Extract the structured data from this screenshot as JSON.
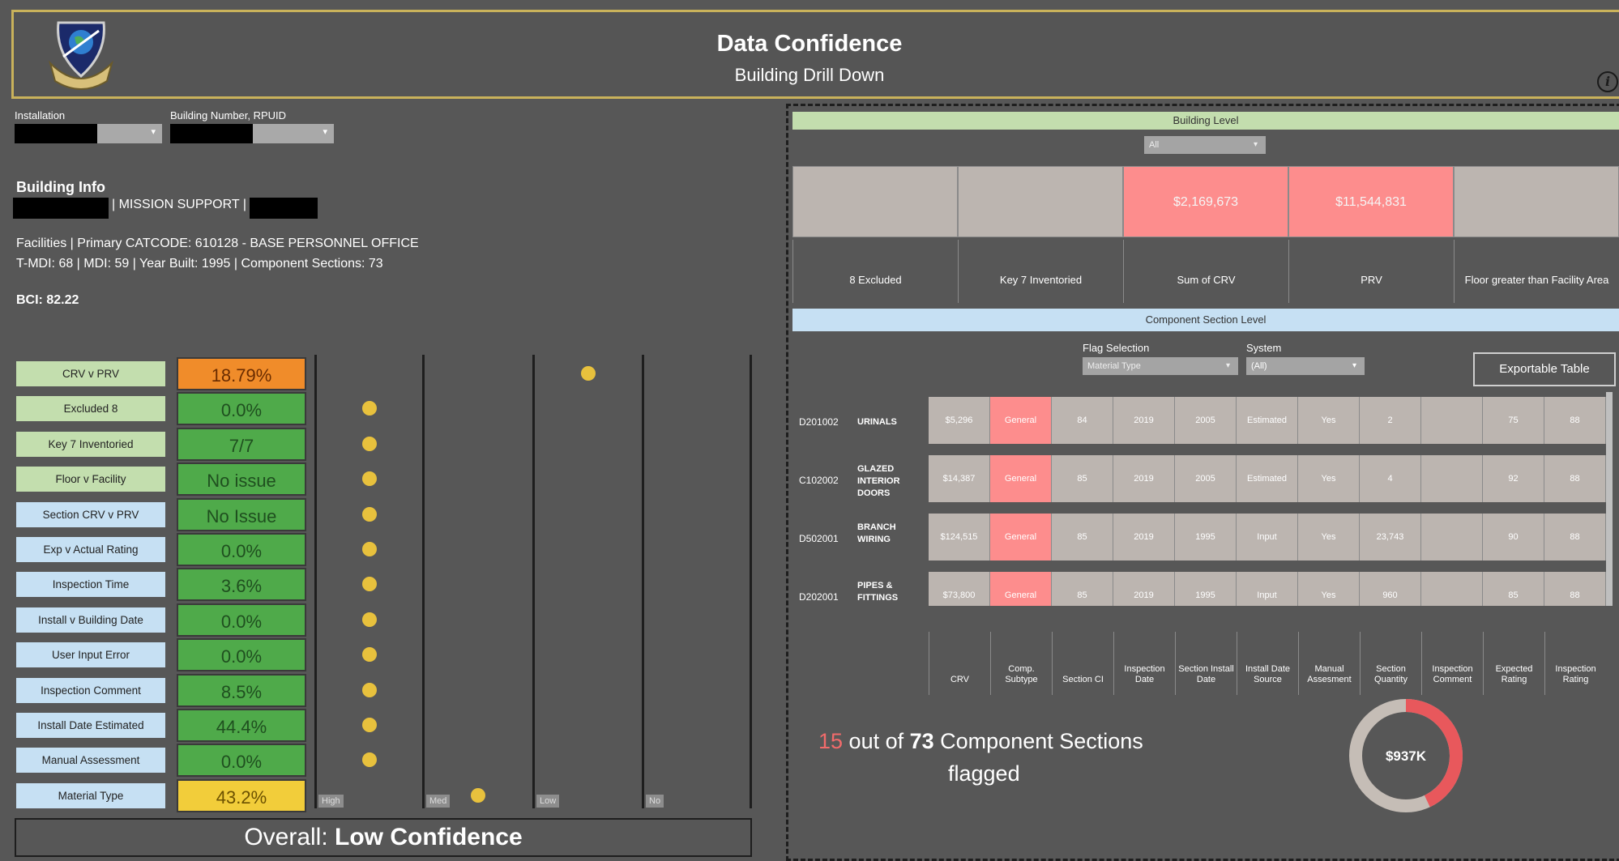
{
  "header": {
    "title": "Data Confidence",
    "subtitle": "Building Drill Down",
    "info_icon": "info-icon",
    "border_color": "#c9b25b"
  },
  "filters": {
    "installation_label": "Installation",
    "building_label": "Building Number, RPUID"
  },
  "building_info": {
    "title": "Building Info",
    "mission_text": "| MISSION SUPPORT |",
    "facilities_line": "Facilities | Primary CATCODE: 610128 - BASE PERSONNEL OFFICE",
    "mdi_line": "T-MDI:  68 | MDI: 59  | Year Built: 1995 | Component Sections: 73",
    "bci": "BCI: 82.22"
  },
  "metrics": [
    {
      "label": "CRV v PRV",
      "value": "18.79%",
      "status": "orange",
      "level": "Low"
    },
    {
      "label": "Excluded 8",
      "value": "0.0%",
      "status": "green",
      "level": "High"
    },
    {
      "label": "Key 7 Inventoried",
      "value": "7/7",
      "status": "green",
      "level": "High"
    },
    {
      "label": "Floor v Facility",
      "value": "No issue",
      "status": "green",
      "level": "High"
    },
    {
      "label": "Section CRV v PRV",
      "value": "No Issue",
      "status": "green",
      "level": "High"
    },
    {
      "label": "Exp v Actual Rating",
      "value": "0.0%",
      "status": "green",
      "level": "High"
    },
    {
      "label": "Inspection Time",
      "value": "3.6%",
      "status": "green",
      "level": "High"
    },
    {
      "label": "Install v Building Date",
      "value": "0.0%",
      "status": "green",
      "level": "High"
    },
    {
      "label": "User Input Error",
      "value": "0.0%",
      "status": "green",
      "level": "High"
    },
    {
      "label": "Inspection Comment",
      "value": "8.5%",
      "status": "green",
      "level": "High"
    },
    {
      "label": "Install Date Estimated",
      "value": "44.4%",
      "status": "green",
      "level": "High"
    },
    {
      "label": "Manual Assessment",
      "value": "0.0%",
      "status": "green",
      "level": "High"
    },
    {
      "label": "Material Type",
      "value": "43.2%",
      "status": "yellow",
      "level": "Med"
    }
  ],
  "confidence_axis": [
    "High",
    "Med",
    "Low",
    "No"
  ],
  "overall": {
    "prefix": "Overall: ",
    "value": "Low Confidence"
  },
  "building_level": {
    "band_title": "Building Level",
    "dropdown_value": "All",
    "kpis": [
      {
        "label": "8 Excluded",
        "value": "",
        "highlight": false
      },
      {
        "label": "Key 7 Inventoried",
        "value": "",
        "highlight": false
      },
      {
        "label": "Sum of CRV",
        "value": "$2,169,673",
        "highlight": true
      },
      {
        "label": "PRV",
        "value": "$11,544,831",
        "highlight": true
      },
      {
        "label": "Floor greater than Facility Area",
        "value": "",
        "highlight": false
      }
    ]
  },
  "component_level": {
    "band_title": "Component Section Level",
    "flag_selection_label": "Flag Selection",
    "flag_selection_value": "Material Type",
    "system_label": "System",
    "system_value": "(All)",
    "export_button": "Exportable Table",
    "columns": [
      "CRV",
      "Comp. Subtype",
      "Section CI",
      "Inspection Date",
      "Section Install Date",
      "Install Date Source",
      "Manual Assesment",
      "Section Quantity",
      "Inspection Comment",
      "Expected Rating",
      "Inspection Rating"
    ],
    "rows": [
      {
        "code": "D201002",
        "name": "URINALS",
        "cells": [
          "$5,296",
          "General",
          "84",
          "2019",
          "2005",
          "Estimated",
          "Yes",
          "2",
          "",
          "75",
          "88"
        ]
      },
      {
        "code": "C102002",
        "name": "GLAZED INTERIOR DOORS",
        "cells": [
          "$14,387",
          "General",
          "85",
          "2019",
          "2005",
          "Estimated",
          "Yes",
          "4",
          "",
          "92",
          "88"
        ]
      },
      {
        "code": "D502001",
        "name": "BRANCH WIRING",
        "cells": [
          "$124,515",
          "General",
          "85",
          "2019",
          "1995",
          "Input",
          "Yes",
          "23,743",
          "",
          "90",
          "88"
        ]
      },
      {
        "code": "D202001",
        "name": "PIPES & FITTINGS",
        "cells": [
          "$73,800",
          "General",
          "85",
          "2019",
          "1995",
          "Input",
          "Yes",
          "960",
          "",
          "85",
          "88"
        ]
      }
    ]
  },
  "flagged": {
    "count": "15",
    "text_mid": " out of ",
    "total": "73",
    "text_end": " Component Sections",
    "line2": "flagged",
    "donut_label": "$937K",
    "donut_fraction": 0.43,
    "donut_colors": {
      "filled": "#e8585c",
      "rest": "#c5bdb6"
    }
  },
  "colors": {
    "green": "#4faa4a",
    "orange": "#f08c2a",
    "yellow": "#f2cd3a",
    "pink": "#fd8d8d",
    "band_green": "#c3deae",
    "band_blue": "#c6e0f3",
    "dot": "#e8c13d"
  }
}
